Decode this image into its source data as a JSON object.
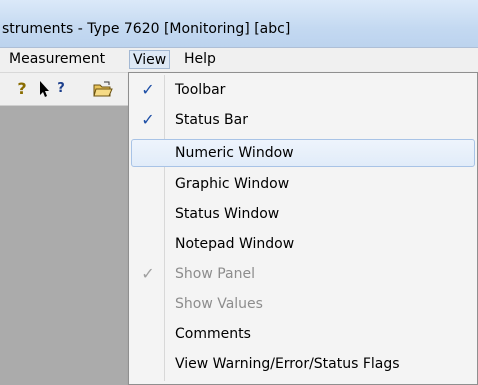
{
  "window": {
    "title": "struments - Type 7620 [Monitoring] [abc]"
  },
  "menubar": {
    "items": [
      {
        "label": "Measurement"
      },
      {
        "label": "View"
      },
      {
        "label": "Help"
      }
    ]
  },
  "toolbar": {
    "help_icon_glyph": "?",
    "context_help_icon_glyph": "?",
    "open_icon_glyph": "🗁"
  },
  "view_menu": {
    "items": [
      {
        "label": "Toolbar",
        "checked": true,
        "enabled": true
      },
      {
        "label": "Status Bar",
        "checked": true,
        "enabled": true
      },
      {
        "label": "Numeric Window",
        "checked": false,
        "enabled": true,
        "highlighted": true
      },
      {
        "label": "Graphic Window",
        "checked": false,
        "enabled": true
      },
      {
        "label": "Status Window",
        "checked": false,
        "enabled": true
      },
      {
        "label": "Notepad Window",
        "checked": false,
        "enabled": true
      },
      {
        "label": "Show Panel",
        "checked": true,
        "enabled": false
      },
      {
        "label": "Show Values",
        "checked": false,
        "enabled": false
      },
      {
        "label": "Comments",
        "checked": false,
        "enabled": true
      },
      {
        "label": "View Warning/Error/Status Flags",
        "checked": false,
        "enabled": true
      }
    ],
    "check_glyph": "✓"
  }
}
